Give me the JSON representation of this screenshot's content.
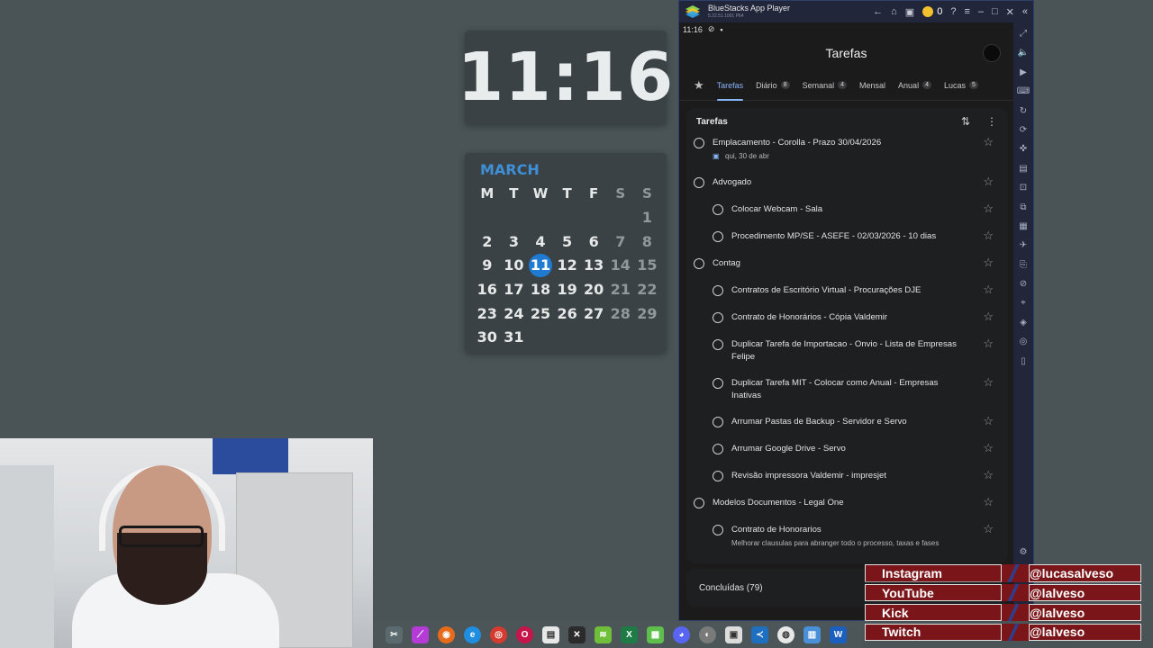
{
  "clock": {
    "time": "11:16"
  },
  "calendar": {
    "month": "MARCH",
    "weekdays": [
      "M",
      "T",
      "W",
      "T",
      "F",
      "S",
      "S"
    ],
    "weeks": [
      [
        "",
        "",
        "",
        "",
        "",
        "",
        "1"
      ],
      [
        "2",
        "3",
        "4",
        "5",
        "6",
        "7",
        "8"
      ],
      [
        "9",
        "10",
        "11",
        "12",
        "13",
        "14",
        "15"
      ],
      [
        "16",
        "17",
        "18",
        "19",
        "20",
        "21",
        "22"
      ],
      [
        "23",
        "24",
        "25",
        "26",
        "27",
        "28",
        "29"
      ],
      [
        "30",
        "31",
        "",
        "",
        "",
        "",
        ""
      ]
    ],
    "today": "11"
  },
  "bluestacks": {
    "app_name": "BlueStacks App Player",
    "version": "5.22.51.1001 P64",
    "coins": "0"
  },
  "status": {
    "time": "11:16"
  },
  "app": {
    "title": "Tarefas",
    "tabs": [
      {
        "label": "Tarefas",
        "count": ""
      },
      {
        "label": "Diário",
        "count": "8"
      },
      {
        "label": "Semanal",
        "count": "4"
      },
      {
        "label": "Mensal",
        "count": ""
      },
      {
        "label": "Anual",
        "count": "4"
      },
      {
        "label": "Lucas",
        "count": "5"
      }
    ],
    "list_title": "Tarefas",
    "tasks": [
      {
        "text": "Emplacamento - Corolla - Prazo 30/04/2026",
        "sub": "qui, 30 de abr",
        "level": 0
      },
      {
        "text": "Advogado",
        "level": 0
      },
      {
        "text": "Colocar Webcam - Sala",
        "level": 1
      },
      {
        "text": "Procedimento MP/SE - ASEFE - 02/03/2026 - 10 dias",
        "level": 1
      },
      {
        "text": "Contag",
        "level": 0
      },
      {
        "text": "Contratos de Escritório Virtual - Procurações DJE",
        "level": 1
      },
      {
        "text": "Contrato de Honorários - Cópia Valdemir",
        "level": 1
      },
      {
        "text": "Duplicar Tarefa de Importacao - Onvio - Lista de Empresas Felipe",
        "level": 1
      },
      {
        "text": "Duplicar Tarefa MIT - Colocar como Anual - Empresas Inativas",
        "level": 1
      },
      {
        "text": "Arrumar Pastas de Backup - Servidor e Servo",
        "level": 1
      },
      {
        "text": "Arrumar Google Drive - Servo",
        "level": 1
      },
      {
        "text": "Revisão impressora Valdemir - impresjet",
        "level": 1
      },
      {
        "text": "Modelos Documentos - Legal One",
        "level": 0
      },
      {
        "text": "Contrato de Honorarios",
        "sub": "Melhorar clausulas para abranger todo o processo, taxas e fases",
        "level": 1
      }
    ],
    "completed": "Concluídas (79)"
  },
  "social": [
    {
      "name": "Instagram",
      "handle": "@lucasalveso"
    },
    {
      "name": "YouTube",
      "handle": "@lalveso"
    },
    {
      "name": "Kick",
      "handle": "@lalveso"
    },
    {
      "name": "Twitch",
      "handle": "@lalveso"
    }
  ],
  "colors": {
    "accent": "#8ab4f8",
    "today": "#1f7ad1",
    "month": "#3e8fd6",
    "social_bg": "#7a1619"
  }
}
